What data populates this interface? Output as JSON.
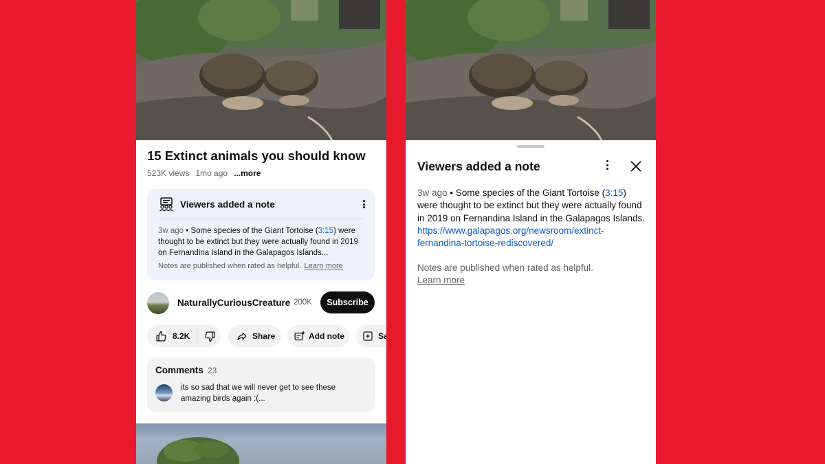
{
  "video": {
    "title": "15 Extinct animals you should know",
    "views": "523K views",
    "age": "1mo ago",
    "more": "...more"
  },
  "note_card": {
    "heading": "Viewers added a note",
    "time": "3w ago",
    "separator": " • ",
    "text_before": "Some species of the Giant Tortoise (",
    "timestamp": "3:15",
    "text_after": ") were thought to be extinct but they were actually found in 2019 on Fernandina Island in the Galapagos Islands...",
    "footer": "Notes are published when rated as helpful.",
    "learn_more": "Learn more"
  },
  "channel": {
    "name": "NaturallyCuriousCreature",
    "subscribers": "200K",
    "subscribe_label": "Subscribe"
  },
  "actions": {
    "likes": "8.2K",
    "share": "Share",
    "add_note": "Add note",
    "save": "Sa"
  },
  "comments": {
    "heading": "Comments",
    "count": "23",
    "top_comment": "its so sad that we will never get to see these amazing birds again :(..."
  },
  "sheet": {
    "title": "Viewers added a note",
    "time": "3w ago",
    "separator": " • ",
    "text_before": "Some species of the Giant Tortoise (",
    "timestamp": "3:15",
    "text_mid": ") were thought to be extinct but they were actually found in 2019 on Fernandina Island in the Galapagos Islands. ",
    "url": "https://www.galapagos.org/newsroom/extinct-fernandina-tortoise-rediscovered/",
    "footer": "Notes are published when rated as helpful.",
    "learn_more": "Learn more"
  },
  "icons": {
    "note": "community-notes-icon",
    "like": "thumbs-up-icon",
    "dislike": "thumbs-down-icon",
    "share": "share-arrow-icon",
    "add_note": "add-note-icon",
    "save": "save-playlist-icon",
    "more": "more-vert-icon",
    "close": "close-icon"
  },
  "colors": {
    "background": "#e8192c",
    "note_card_bg": "#eef3fb",
    "link": "#065fd4",
    "subscribe_bg": "#0f0f0f"
  }
}
